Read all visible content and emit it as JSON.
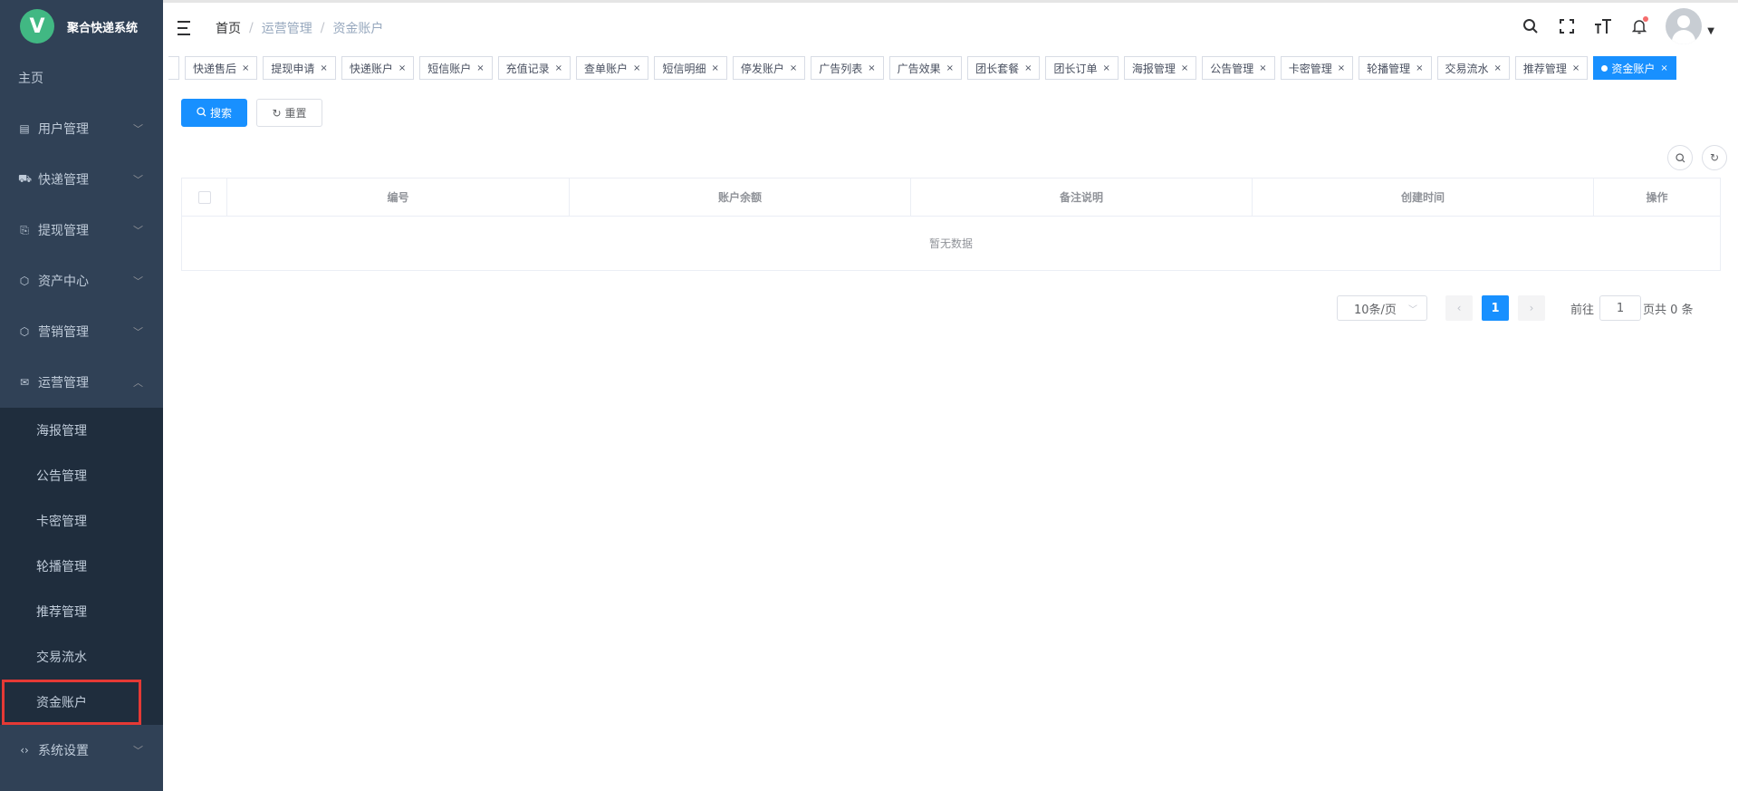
{
  "app": {
    "title": "聚合快递系统",
    "logo_letter": "V"
  },
  "sidebar": {
    "home": "主页",
    "items": [
      {
        "label": "用户管理",
        "icon": "database-icon"
      },
      {
        "label": "快递管理",
        "icon": "package-icon"
      },
      {
        "label": "提现管理",
        "icon": "withdraw-icon"
      },
      {
        "label": "资产中心",
        "icon": "cube-icon"
      },
      {
        "label": "营销管理",
        "icon": "cube-icon"
      },
      {
        "label": "运营管理",
        "icon": "mail-icon"
      }
    ],
    "submenu": [
      "海报管理",
      "公告管理",
      "卡密管理",
      "轮播管理",
      "推荐管理",
      "交易流水",
      "资金账户"
    ],
    "settings": "系统设置"
  },
  "breadcrumb": {
    "home": "首页",
    "level1": "运营管理",
    "level2": "资金账户"
  },
  "tags": [
    "快递售后",
    "提现申请",
    "快递账户",
    "短信账户",
    "充值记录",
    "查单账户",
    "短信明细",
    "停发账户",
    "广告列表",
    "广告效果",
    "团长套餐",
    "团长订单",
    "海报管理",
    "公告管理",
    "卡密管理",
    "轮播管理",
    "交易流水",
    "推荐管理"
  ],
  "active_tag": "资金账户",
  "toolbar": {
    "search_label": "搜索",
    "reset_label": "重置"
  },
  "table": {
    "columns": [
      "编号",
      "账户余额",
      "备注说明",
      "创建时间",
      "操作"
    ],
    "empty_text": "暂无数据"
  },
  "pagination": {
    "page_size": "10条/页",
    "current_page": "1",
    "goto_label": "前往",
    "goto_value": "1",
    "total_text": "页共 0 条"
  }
}
